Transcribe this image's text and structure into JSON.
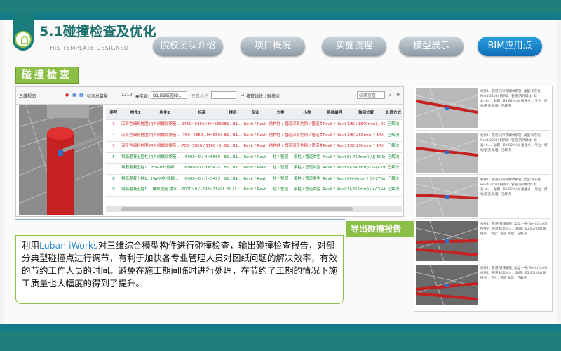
{
  "header": {
    "title": "5.1碰撞检查及优化",
    "subtitle": "THIS TEMPLATE DESIGNED"
  },
  "tabs": [
    {
      "label": "院校团队介绍",
      "active": false
    },
    {
      "label": "项目概况",
      "active": false
    },
    {
      "label": "实施流程",
      "active": false
    },
    {
      "label": "模型展示",
      "active": false
    },
    {
      "label": "BIM应用点",
      "active": true
    }
  ],
  "section_label": "碰撞检查",
  "app": {
    "view_label": "三维视图",
    "total_label": "检测总数量：",
    "total_value": "1310",
    "floor_label": "◉楼层:",
    "floor_value": "B1,B1结施(B…",
    "filter_label": "只看标注",
    "group_label": "按管线统计碰撞点",
    "result_value": "结果查看",
    "columns": [
      "序号",
      "构件1",
      "构件2",
      "标高",
      "楼层",
      "专业",
      "大类",
      "小类",
      "系统编号",
      "轴网位置",
      "处理方式"
    ],
    "rows": [
      {
        "no": "3",
        "c1": "深灰色细粉桩围…",
        "c2": "内外侧螺纹钢筋…",
        "elev": "-2450~5850 / H=5560",
        "floor": "B1 / B1…",
        "major": "Revit / Revit",
        "cat": "结构柱 / 管道",
        "sub": "深灰色钢 / 管道类型",
        "sys": "Revit / Revit",
        "axis": "1/5(+1649mm) / 006-106…",
        "action": "已解决",
        "red": true
      },
      {
        "no": "4",
        "c1": "深灰色细粉桩围…",
        "c2": "内外侧螺纹钢筋…",
        "elev": "-750~5850 / H=5560",
        "floor": "B1 / B1…",
        "major": "Revit / Revit",
        "cat": "结构柱 / 管道",
        "sub": "深灰色钢 / 管道类型",
        "sys": "Revit / Revit",
        "axis": "1/5(-265mm) / 1/U(+1196…",
        "action": "已解决",
        "red": true
      },
      {
        "no": "5",
        "c1": "深灰色细粉桩围…",
        "c2": "内外侧螺纹钢筋…",
        "elev": "-750~5850 / 1160~5…",
        "floor": "B1 / B1…",
        "major": "Revit / Revit",
        "cat": "结构柱 / 管道",
        "sub": "深灰色钢 / 管道类型",
        "sys": "Revit / Revit",
        "axis": "1/5(-298mm) / 1/U(+1mm)",
        "action": "已解决",
        "red": true
      },
      {
        "no": "6",
        "c1": "钢筋混凝土圆柱…",
        "c2": "内外侧螺纹钢筋…",
        "elev": "-6000~0 / H=5560",
        "floor": "B1 / B1…",
        "major": "Revit / Revit",
        "cat": "柱 / 管道",
        "sub": "梁柱 / 管道类型",
        "sys": "Revit / Revit",
        "axis": "B(-714mm) / J(-509mm)",
        "action": "已解决",
        "red": false
      },
      {
        "no": "7",
        "c1": "钢筋混凝土柱1…",
        "c2": "HW-H外侧螺…",
        "elev": "-6000~0 / H=5425",
        "floor": "B1 / B1…",
        "major": "Revit / Revit",
        "cat": "柱 / 管道",
        "sub": "梁柱 / 管道类型",
        "sys": "Revit / Revit",
        "axis": "6(-340mm) / G(+199mm)",
        "action": "已解决",
        "red": false
      },
      {
        "no": "8",
        "c1": "钢筋混凝土柱1…",
        "c2": "HW-内外侧螺…",
        "elev": "-6000~0 / H=5425",
        "floor": "B1 / B1…",
        "major": "Revit / Revit",
        "cat": "柱 / 管道",
        "sub": "梁柱 / 管道类型",
        "sys": "Revit / Revit",
        "axis": "6(+0mm) / G(-276mm)",
        "action": "已解决",
        "red": false
      },
      {
        "no": "9",
        "c1": "钢筋混凝土柱1…",
        "c2": "螺纹钢筋 镀水",
        "elev": "-6000~0 / -298~11498",
        "floor": "B1 / L1",
        "major": "Revit / Revit",
        "cat": "柱 / 管道",
        "sub": "梁柱 / 管道类型",
        "sys": "Revit / Revit",
        "axis": "1(-355mm) / 4/D(+62mm)",
        "action": "已解决",
        "red": false
      }
    ]
  },
  "report_button": "导出碰撞报告",
  "description": {
    "pre": "利用",
    "highlight": "Luban iWorks",
    "post": "对三维综合模型构件进行碰撞检查，输出碰撞检查报告，对部分典型碰撞点进行调节，有利于加快各专业管理人员对图纸问题的解决效率，有效的节约工作人员的时间。避免在施工期间临时进行处理，在节约了工期的情况下施工质量也大幅度的得到了提升。"
  },
  "thumbnails": [
    {
      "text": "构件1：管道(内外侧螺纹钢管) 类型:深灰色 Revit(2203) 构件2：管道(内外螺纹) 标高:H=… 轴网：B2,B2/d(d) 碰撞点… 专业：结构/管道 处理：已解决"
    },
    {
      "text": "构件1：管道(内外侧螺纹钢管) 类型:深灰色 Revit(2203) 构件2：管道(内外螺纹) 标高:H=… 轴网：B2,B2/d(d) 碰撞点… 专业：结构/管道 处理：已解决"
    },
    {
      "text": "构件1：管道(内外侧螺纹钢管) 类型:深灰色 Revit(2203) 构件2：管道(内外螺纹) 标高:H=… 轴网：B2,B2/d(d) 碰撞点… 专业：结构/管道 处理：已解决"
    },
    {
      "text": "构件1：管道(镀锌钢管) 类型:一般 Revit(2203) 构件2：管道 标高:H=… 轴网：B2,B2/d(d) 碰撞点… 专业：管道 处理：已解决"
    },
    {
      "text": "构件1：管道(镀锌钢管) 类型:一般 Revit(2203) 构件2：管道 标高:H=… 轴网：B2,B2/d(d) 碰撞点… 专业：管道 处理：已解决"
    }
  ],
  "colors": {
    "teal": "#1f7f7b",
    "green": "#8bbf47",
    "blue_tab": "#0f6eb6"
  }
}
